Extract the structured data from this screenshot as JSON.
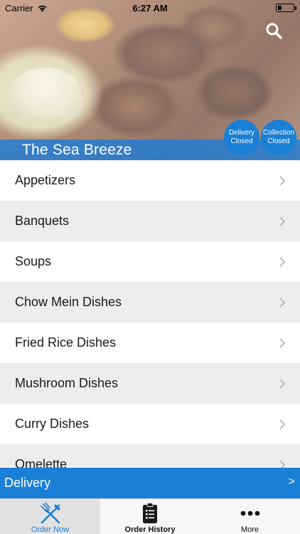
{
  "status_bar": {
    "carrier": "Carrier",
    "time": "6:27 AM",
    "battery_level": 0.25
  },
  "header": {
    "restaurant_name": "The Sea Breeze",
    "delivery_status": {
      "line1": "Delivery",
      "line2": "Closed"
    },
    "collection_status": {
      "line1": "Collection",
      "line2": "Closed"
    },
    "search_icon": "search-icon"
  },
  "menu": {
    "categories": [
      {
        "label": "Appetizers"
      },
      {
        "label": "Banquets"
      },
      {
        "label": "Soups"
      },
      {
        "label": "Chow Mein Dishes"
      },
      {
        "label": "Fried Rice Dishes"
      },
      {
        "label": "Mushroom Dishes"
      },
      {
        "label": "Curry Dishes"
      },
      {
        "label": "Omelette"
      }
    ]
  },
  "delivery_bar": {
    "label": "Delivery",
    "arrow": ">"
  },
  "tab_bar": {
    "tabs": [
      {
        "label": "Order Now",
        "icon": "fork-knife-icon",
        "active": true
      },
      {
        "label": "Order History",
        "icon": "clipboard-list-icon",
        "active": false
      },
      {
        "label": "More",
        "icon": "more-dots-icon",
        "active": false
      }
    ]
  },
  "colors": {
    "accent": "#1a7fd6",
    "list_alt_row": "#ededed"
  }
}
